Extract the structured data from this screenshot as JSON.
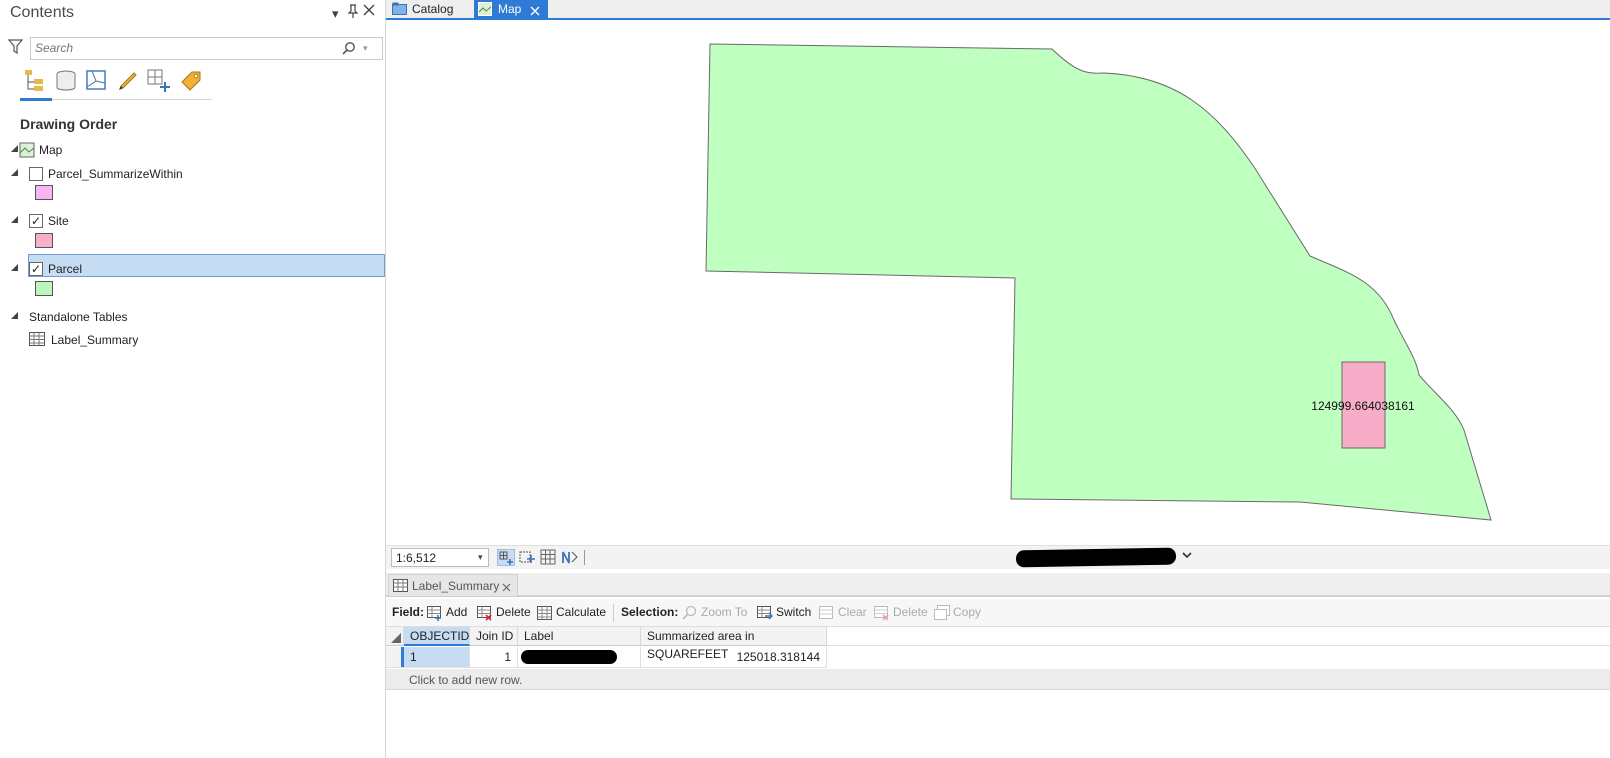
{
  "contents": {
    "title": "Contents",
    "search_placeholder": "Search",
    "drawing_order_label": "Drawing Order",
    "tree": {
      "map": "Map",
      "layer1": "Parcel_SummarizeWithin",
      "layer2": "Site",
      "layer3": "Parcel",
      "standalone_group": "Standalone Tables",
      "table1": "Label_Summary"
    },
    "layer_checks": {
      "layer1": false,
      "layer2": true,
      "layer3": true
    },
    "swatches": {
      "layer1": "#f8b4f4",
      "layer2": "#f8b0c8",
      "layer3": "#bdf5bd"
    }
  },
  "tabs": {
    "catalog": "Catalog",
    "map": "Map"
  },
  "map": {
    "parcel_fill": "#bfffc0",
    "site_fill": "#f7adc8",
    "feature_label": "124999.664038161"
  },
  "status": {
    "scale": "1:6,512"
  },
  "table_pane": {
    "tab_label": "Label_Summary",
    "toolbar": {
      "field_label": "Field:",
      "add": "Add",
      "delete": "Delete",
      "calculate": "Calculate",
      "selection_label": "Selection:",
      "zoom_to": "Zoom To",
      "switch": "Switch",
      "clear": "Clear",
      "sel_delete": "Delete",
      "copy": "Copy"
    },
    "columns": [
      "OBJECTID",
      "Join ID",
      "Label",
      "Summarized area in SQUAREFEET"
    ],
    "row": {
      "objectid": "1",
      "join_id": "1",
      "area": "125018.318144"
    },
    "add_row_text": "Click to add new row."
  }
}
